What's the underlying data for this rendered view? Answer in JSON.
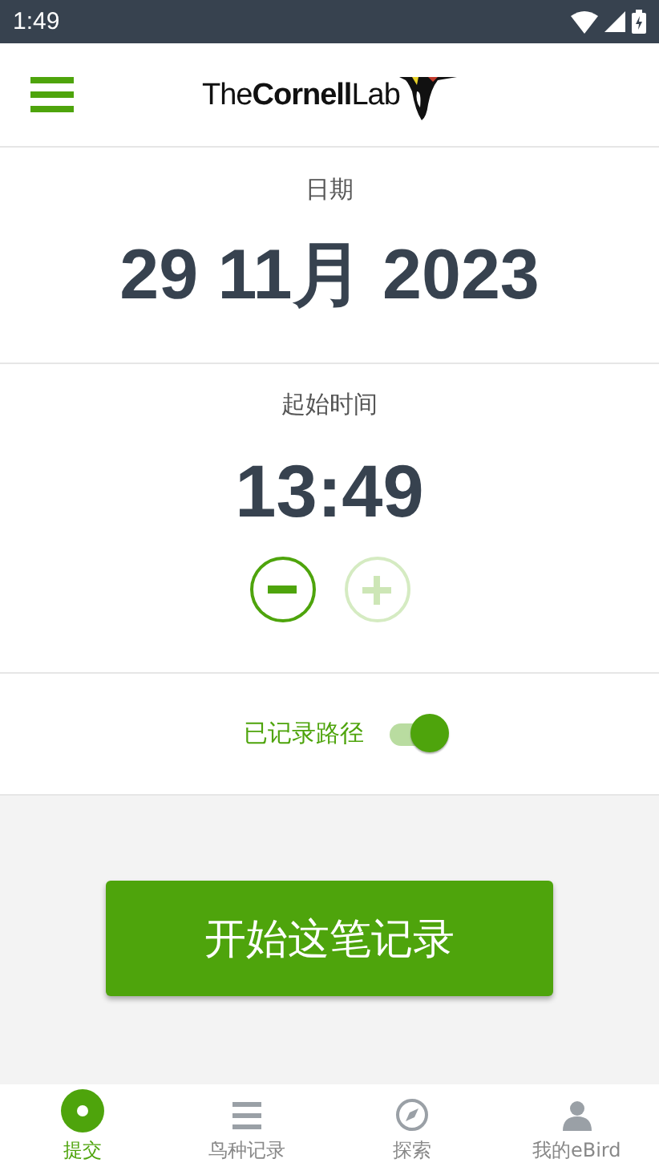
{
  "status_bar": {
    "time": "1:49"
  },
  "header": {
    "logo": "The**Cornell**Lab"
  },
  "date": {
    "label": "日期",
    "value": "29 11月 2023"
  },
  "start_time": {
    "label": "起始时间",
    "value": "13:49",
    "steppers": [
      {
        "kind": "minus",
        "disabled": false
      },
      {
        "kind": "plus",
        "disabled": true
      }
    ]
  },
  "track": {
    "label": "已记录路径",
    "on": true
  },
  "start_button": "开始这笔记录",
  "tabs": [
    {
      "label": "提交",
      "kind": "submit",
      "selected": true
    },
    {
      "label": "鸟种记录",
      "kind": "list",
      "selected": false
    },
    {
      "label": "探索",
      "kind": "explore",
      "selected": false
    },
    {
      "label": "我的eBird",
      "kind": "profile",
      "selected": false
    }
  ]
}
